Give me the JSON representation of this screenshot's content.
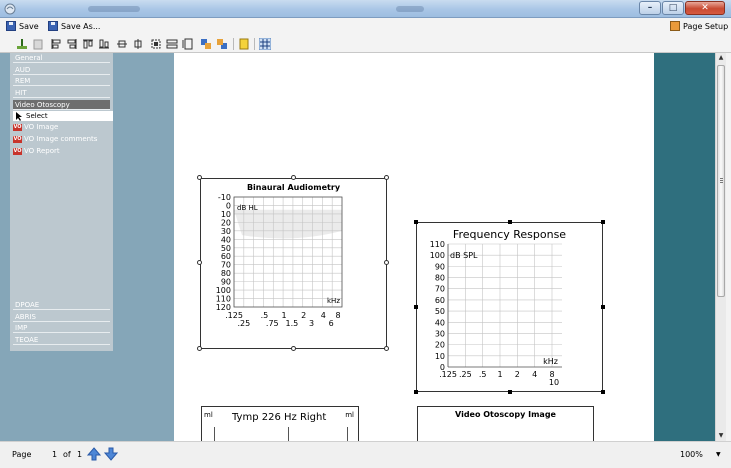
{
  "window": {
    "title": ""
  },
  "actions": {
    "save": "Save",
    "save_as": "Save As...",
    "page_setup": "Page Setup"
  },
  "nav": {
    "top_items": [
      "General",
      "AUD",
      "REM",
      "HIT",
      "Video Otoscopy"
    ],
    "active": "Video Otoscopy",
    "sub_items": [
      {
        "label": "Select",
        "icon": "cursor-arrow-icon"
      },
      {
        "label": "VO Image",
        "icon": "vo-icon"
      },
      {
        "label": "VO Image comments",
        "icon": "vo-icon"
      },
      {
        "label": "VO Report",
        "icon": "vo-icon"
      }
    ],
    "bottom_items": [
      "DPOAE",
      "ABRIS",
      "IMP",
      "TEOAE"
    ]
  },
  "status": {
    "page_label": "Page",
    "page_current": "1",
    "page_of": "of",
    "page_total": "1",
    "zoom": "100%"
  },
  "charts": {
    "audiometry": {
      "title": "Binaural Audiometry",
      "unit_label": "dB HL",
      "x_unit": "kHz"
    },
    "frequency": {
      "title": "Frequency Response",
      "unit_label": "dB SPL",
      "x_unit": "kHz"
    },
    "tymp": {
      "title": "Tymp 226 Hz Right",
      "left_unit": "ml",
      "right_unit": "ml"
    },
    "vo_image": {
      "title": "Video Otoscopy Image"
    }
  },
  "chart_data": [
    {
      "type": "line",
      "title": "Binaural Audiometry",
      "ylabel": "dB HL",
      "xlabel": "kHz",
      "y_ticks": [
        -10,
        0,
        10,
        20,
        30,
        40,
        50,
        60,
        70,
        80,
        90,
        100,
        110,
        120
      ],
      "ylim": [
        -10,
        120
      ],
      "x_ticks_row1": [
        ".125",
        ".5",
        "1",
        "2",
        "4",
        "8"
      ],
      "x_ticks_row2": [
        ".25",
        ".75",
        "1.5",
        "3",
        "6"
      ],
      "grid": true,
      "series": []
    },
    {
      "type": "line",
      "title": "Frequency Response",
      "ylabel": "dB SPL",
      "xlabel": "kHz",
      "y_ticks": [
        0,
        10,
        20,
        30,
        40,
        50,
        60,
        70,
        80,
        90,
        100,
        110
      ],
      "ylim": [
        0,
        110
      ],
      "x_ticks": [
        ".125",
        ".25",
        ".5",
        "1",
        "2",
        "4",
        "8"
      ],
      "x_tick_extra": "10",
      "grid": true,
      "series": []
    }
  ],
  "colors": {
    "left_panel": "#85a6b8",
    "right_panel": "#2f6f7e",
    "nav_active": "#6e6e6e",
    "vo_icon": "#c8342c"
  }
}
